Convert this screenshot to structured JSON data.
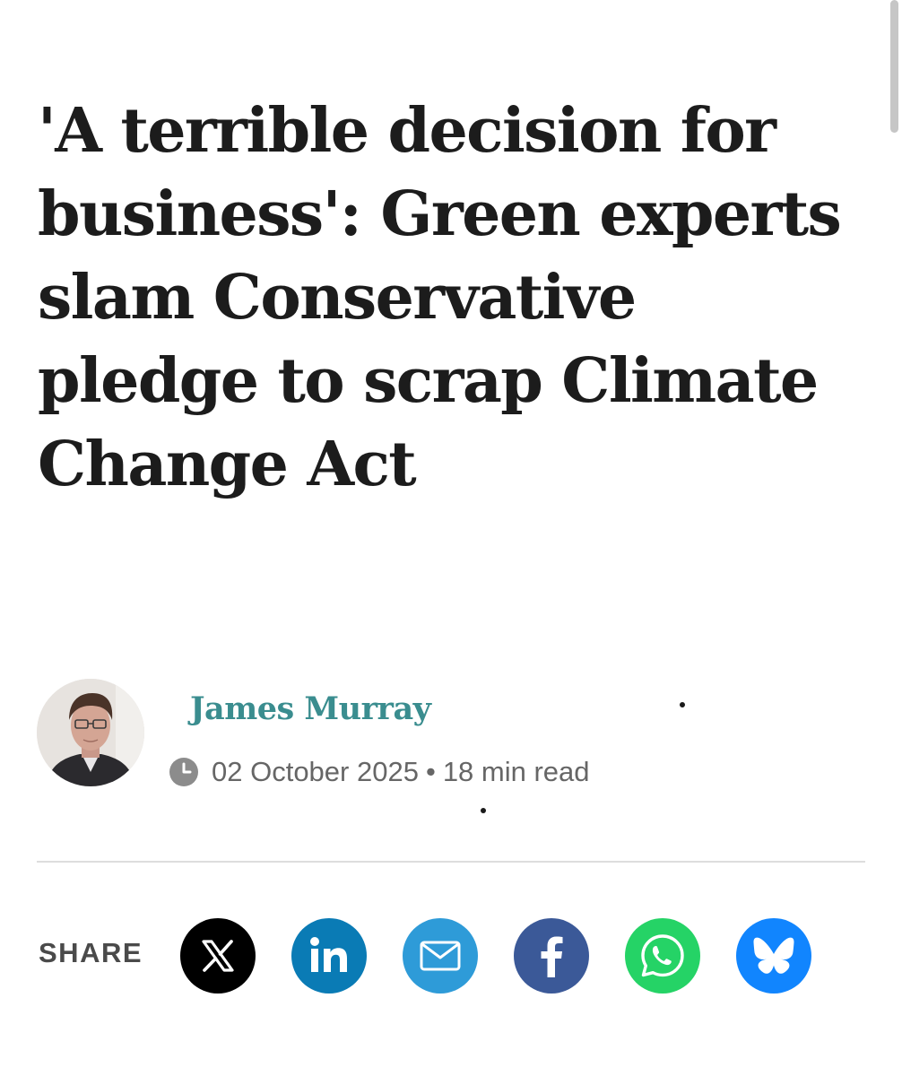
{
  "article": {
    "headline": "'A terrible decision for business': Green experts slam Conservative pledge to scrap Climate Change Act",
    "author": "James Murray",
    "date": "02 October 2025",
    "separator": "•",
    "read_time": "18 min read"
  },
  "share": {
    "label": "SHARE",
    "buttons": [
      {
        "name": "x",
        "icon": "x-logo-icon",
        "color": "#000000"
      },
      {
        "name": "linkedin",
        "icon": "linkedin-icon",
        "color": "#0a7bb5"
      },
      {
        "name": "email",
        "icon": "envelope-icon",
        "color": "#2e9bd8"
      },
      {
        "name": "facebook",
        "icon": "facebook-icon",
        "color": "#3b5998"
      },
      {
        "name": "whatsapp",
        "icon": "whatsapp-icon",
        "color": "#25d366"
      },
      {
        "name": "bluesky",
        "icon": "butterfly-icon",
        "color": "#1185fe"
      }
    ]
  },
  "colors": {
    "headline": "#1c1c1c",
    "author": "#3a8d8f",
    "meta": "#666666",
    "divider": "#dddddd"
  }
}
